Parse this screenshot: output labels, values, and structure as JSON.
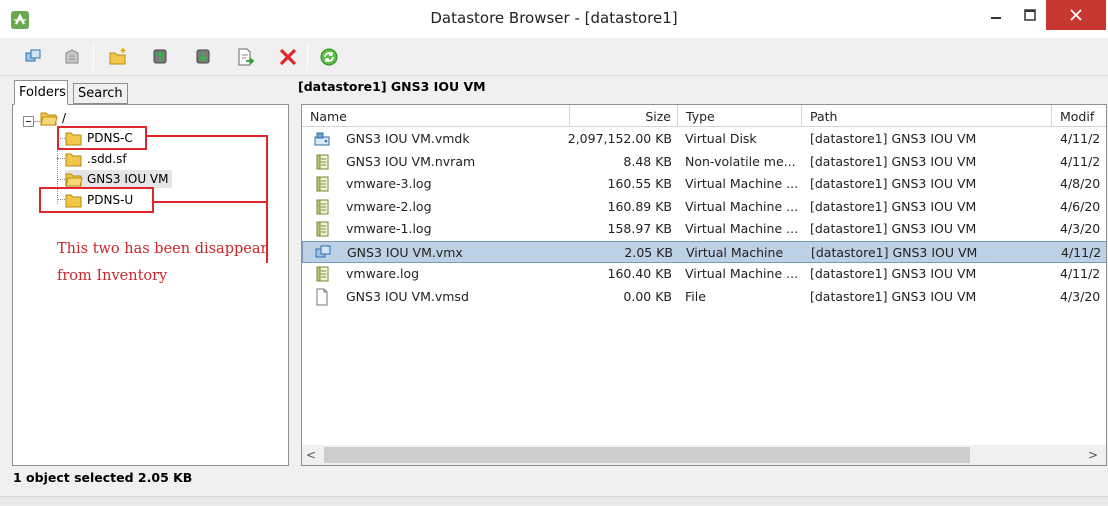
{
  "window": {
    "title": "Datastore Browser - [datastore1]",
    "close_color": "#c7372f"
  },
  "toolbar": {
    "buttons": [
      {
        "icon": "datastore-browse-icon"
      },
      {
        "icon": "datastore-disabled-icon"
      },
      {
        "icon": "new-folder-icon"
      },
      {
        "icon": "upload-icon"
      },
      {
        "icon": "download-icon"
      },
      {
        "icon": "move-file-icon"
      },
      {
        "icon": "delete-icon"
      },
      {
        "icon": "refresh-icon"
      }
    ]
  },
  "left": {
    "tabs": [
      "Folders",
      "Search"
    ],
    "tree": {
      "root": "/",
      "children": [
        "PDNS-C",
        ".sdd.sf",
        "GNS3 IOU VM",
        "PDNS-U"
      ]
    },
    "annotation": {
      "line1": "This two has been disappear",
      "line2": "from Inventory",
      "color": "#e0262c"
    }
  },
  "right": {
    "path": "[datastore1] GNS3 IOU VM",
    "columns": [
      "Name",
      "Size",
      "Type",
      "Path",
      "Modif"
    ],
    "rows": [
      {
        "icon": "virtual-disk-icon",
        "name": "GNS3 IOU VM.vmdk",
        "size": "2,097,152.00 KB",
        "type": "Virtual Disk",
        "path": "[datastore1] GNS3 IOU VM",
        "mod": "4/11/2"
      },
      {
        "icon": "log-file-icon",
        "name": "GNS3 IOU VM.nvram",
        "size": "8.48 KB",
        "type": "Non-volatile me...",
        "path": "[datastore1] GNS3 IOU VM",
        "mod": "4/11/2"
      },
      {
        "icon": "log-file-icon",
        "name": "vmware-3.log",
        "size": "160.55 KB",
        "type": "Virtual Machine ...",
        "path": "[datastore1] GNS3 IOU VM",
        "mod": "4/8/20"
      },
      {
        "icon": "log-file-icon",
        "name": "vmware-2.log",
        "size": "160.89 KB",
        "type": "Virtual Machine ...",
        "path": "[datastore1] GNS3 IOU VM",
        "mod": "4/6/20"
      },
      {
        "icon": "log-file-icon",
        "name": "vmware-1.log",
        "size": "158.97 KB",
        "type": "Virtual Machine ...",
        "path": "[datastore1] GNS3 IOU VM",
        "mod": "4/3/20"
      },
      {
        "icon": "virtual-machine-icon",
        "name": "GNS3 IOU VM.vmx",
        "size": "2.05 KB",
        "type": "Virtual Machine",
        "path": "[datastore1] GNS3 IOU VM",
        "mod": "4/11/2",
        "selected": true
      },
      {
        "icon": "log-file-icon",
        "name": "vmware.log",
        "size": "160.40 KB",
        "type": "Virtual Machine ...",
        "path": "[datastore1] GNS3 IOU VM",
        "mod": "4/11/2"
      },
      {
        "icon": "blank-file-icon",
        "name": "GNS3 IOU VM.vmsd",
        "size": "0.00 KB",
        "type": "File",
        "path": "[datastore1] GNS3 IOU VM",
        "mod": "4/3/20"
      }
    ],
    "scroll_left": "<",
    "scroll_right": ">"
  },
  "status": {
    "text": "1 object selected 2.05 KB"
  }
}
